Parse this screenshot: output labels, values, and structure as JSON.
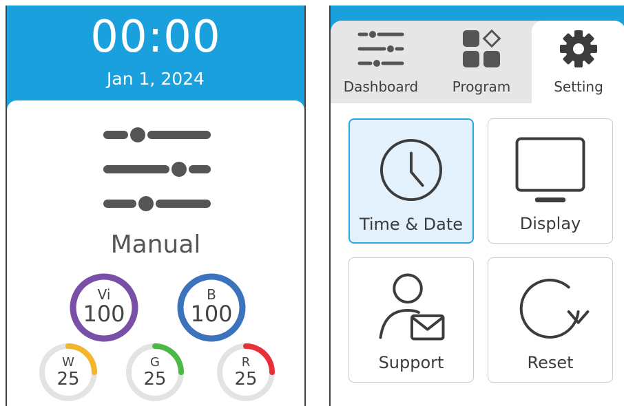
{
  "clock": {
    "time": "00:00",
    "date": "Jan 1, 2024"
  },
  "mode": {
    "label": "Manual",
    "icon": "sliders-icon"
  },
  "gauges": [
    {
      "channel": "Vi",
      "value": "100",
      "level": 1.0,
      "color": "#7a4fa8"
    },
    {
      "channel": "B",
      "value": "100",
      "level": 1.0,
      "color": "#3c73bd"
    },
    {
      "channel": "W",
      "value": "25",
      "level": 0.25,
      "color": "#f2b62c"
    },
    {
      "channel": "G",
      "value": "25",
      "level": 0.25,
      "color": "#4cb848"
    },
    {
      "channel": "R",
      "value": "25",
      "level": 0.25,
      "color": "#e8303a"
    }
  ],
  "nav": {
    "tabs": [
      {
        "label": "Dashboard",
        "icon": "sliders-icon",
        "active": false
      },
      {
        "label": "Program",
        "icon": "program-grid-icon",
        "active": false
      },
      {
        "label": "Setting",
        "icon": "gear-icon",
        "active": true
      }
    ]
  },
  "settings": {
    "tiles": [
      {
        "label": "Time & Date",
        "icon": "clock-icon",
        "selected": true
      },
      {
        "label": "Display",
        "icon": "monitor-icon",
        "selected": false
      },
      {
        "label": "Support",
        "icon": "support-user-mail-icon",
        "selected": false
      },
      {
        "label": "Reset",
        "icon": "reset-arrow-icon",
        "selected": false
      }
    ]
  },
  "colors": {
    "accent": "#1aa0dc",
    "selected_tile_bg": "#e2f1fb",
    "selected_tile_border": "#2aa6e0",
    "icon": "#3c3c3c",
    "gauge_track": "#e3e3e3"
  }
}
